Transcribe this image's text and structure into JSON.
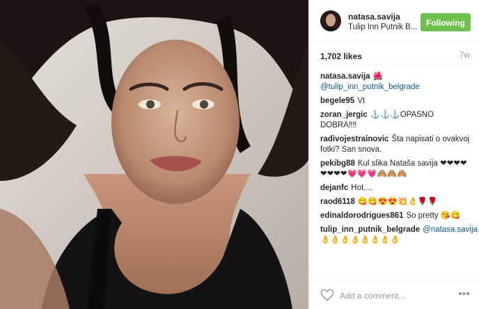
{
  "header": {
    "username": "natasa.savija",
    "location": "Tulip Inn Putnik B...",
    "follow_label": "Following",
    "avatar_icon": "profile-avatar",
    "follow_color": "#70c050"
  },
  "stats": {
    "likes": "1,702 likes",
    "time": "7w"
  },
  "caption": {
    "user": "natasa.savija",
    "emoji": "🌺",
    "mention": "@tulip_inn_putnik_belgrade"
  },
  "comments": [
    {
      "user": "begele95",
      "text": "Vt"
    },
    {
      "user": "zoran_jergic",
      "text": "⚓⚓⚓OPASNO DOBRA‼‼"
    },
    {
      "user": "radivojestrainovic",
      "text": "Šta napisati o ovakvoj fotki? San snova."
    },
    {
      "user": "pekibg88",
      "text": "Kul slika Nataša savija ❤❤❤❤❤❤❤❤💗💗💗🙈🙈🙈"
    },
    {
      "user": "dejanfc",
      "text": "Hot...."
    },
    {
      "user": "raod6118",
      "text": "😋😋😍😍💥👌🌹🌹"
    },
    {
      "user": "edinaldorodrigues861",
      "text": "So pretty 😘😋"
    },
    {
      "user": "tulip_inn_putnik_belgrade",
      "mention": "@natasa.savija",
      "text": "👌👌👌👌👌👌👌👌"
    }
  ],
  "footer": {
    "placeholder": "Add a comment...",
    "heart_icon": "heart-outline-icon",
    "more_icon": "more-dots-icon",
    "more_glyph": "•••"
  }
}
